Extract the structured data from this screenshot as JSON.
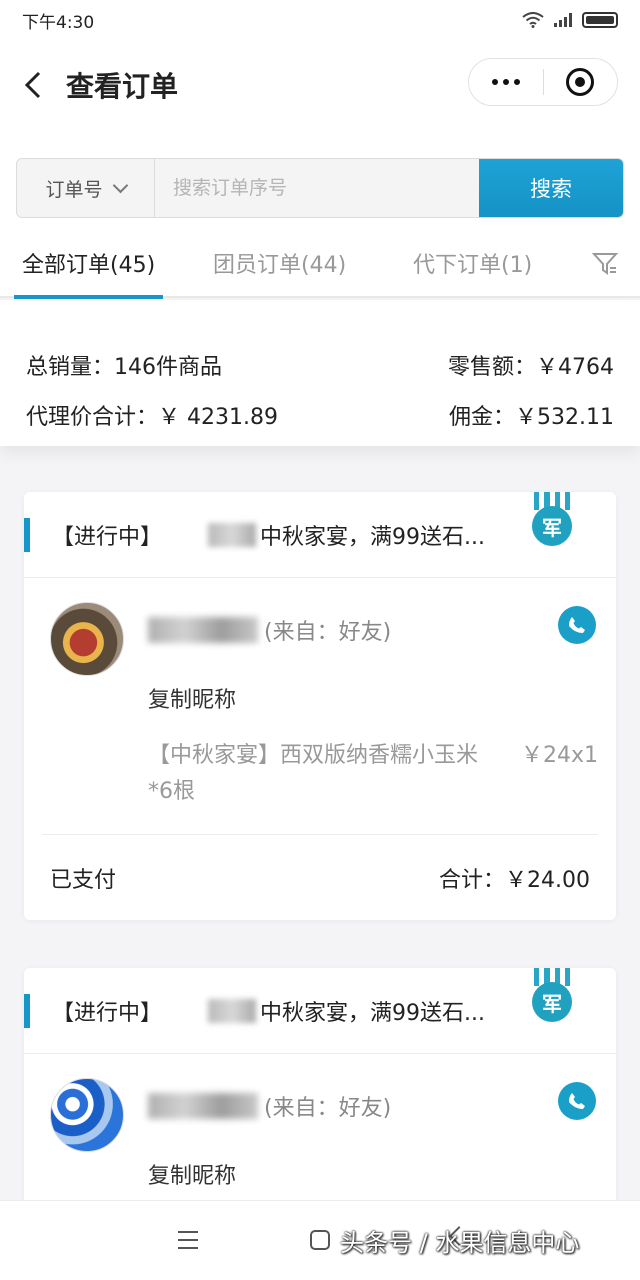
{
  "status_bar": {
    "time": "下午4:30"
  },
  "nav": {
    "title": "查看订单"
  },
  "search": {
    "select_label": "订单号",
    "placeholder": "搜索订单序号",
    "button": "搜索"
  },
  "tabs": [
    {
      "label": "全部订单(45)",
      "active": true
    },
    {
      "label": "团员订单(44)",
      "active": false
    },
    {
      "label": "代下订单(1)",
      "active": false
    }
  ],
  "summary": {
    "total_sales": "总销量：146件商品",
    "retail_amount": "零售额：￥4764",
    "agent_total": "代理价合计：￥ 4231.89",
    "commission": "佣金：￥532.11"
  },
  "orders": [
    {
      "status": "【进行中】",
      "product_title": "中秋家宴，满99送石...",
      "source": "(来自：好友)",
      "copy_nickname": "复制昵称",
      "product_name": "【中秋家宴】西双版纳香糯小玉米*6根",
      "product_price": "￥24x1",
      "payment_status": "已支付",
      "total": "合计：￥24.00"
    },
    {
      "status": "【进行中】",
      "product_title": "中秋家宴，满99送石...",
      "source": "(来自：好友)",
      "copy_nickname": "复制昵称"
    }
  ],
  "badge_char": "军",
  "watermark": "头条号 / 水果信息中心",
  "colors": {
    "accent": "#1797c9",
    "button": "#1592c6"
  }
}
